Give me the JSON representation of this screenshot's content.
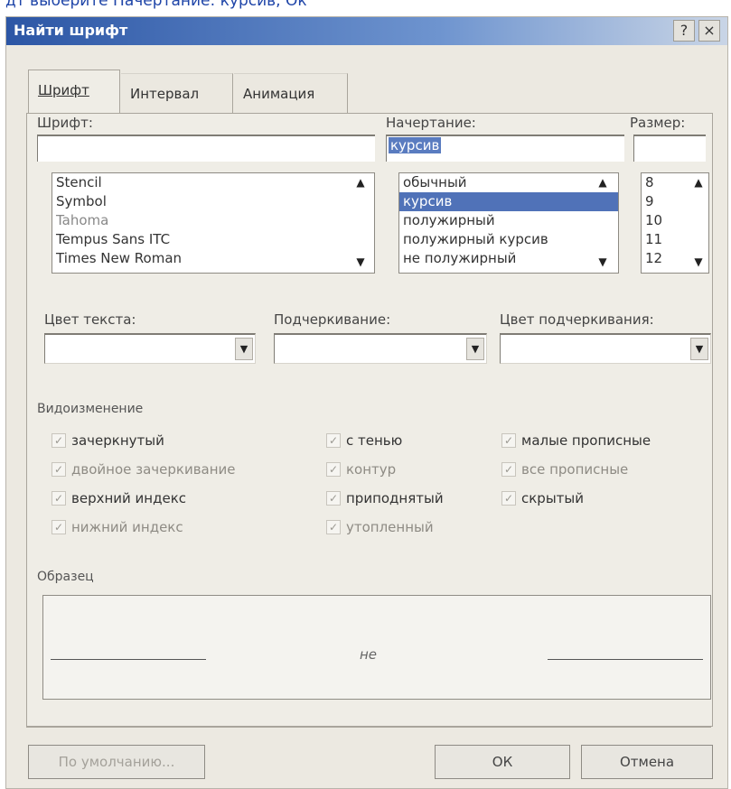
{
  "caption": "дт выберите Начертание: курсив, Ок",
  "window": {
    "title": "Найти шрифт",
    "help": "?",
    "close": "×"
  },
  "tabs": [
    "Шрифт",
    "Интервал",
    "Анимация"
  ],
  "font": {
    "label": "Шрифт:",
    "value": "",
    "items": [
      "Stencil",
      "Symbol",
      "Tahoma",
      "Tempus Sans ITC",
      "Times New Roman"
    ]
  },
  "style": {
    "label": "Начертание:",
    "value": "курсив",
    "items": [
      "обычный",
      "курсив",
      "полужирный",
      "полужирный курсив",
      "не полужирный"
    ],
    "selected": "курсив"
  },
  "size": {
    "label": "Размер:",
    "value": "",
    "items": [
      "8",
      "9",
      "10",
      "11",
      "12"
    ]
  },
  "text_color": {
    "label": "Цвет текста:",
    "value": ""
  },
  "underline": {
    "label": "Подчеркивание:",
    "value": ""
  },
  "underline_color": {
    "label": "Цвет подчеркивания:",
    "value": ""
  },
  "effects": {
    "title": "Видоизменение",
    "col1": [
      "зачеркнутый",
      "двойное зачеркивание",
      "верхний индекс",
      "нижний индекс"
    ],
    "col2": [
      "с тенью",
      "контур",
      "приподнятый",
      "утопленный"
    ],
    "col3": [
      "малые прописные",
      "все прописные",
      "скрытый"
    ]
  },
  "sample": {
    "title": "Образец",
    "text": "не"
  },
  "buttons": {
    "default": "По умолчанию...",
    "ok": "ОК",
    "cancel": "Отмена"
  },
  "colors": {
    "title_bar_start": "#2c56a5",
    "selection": "#5072b8",
    "dialog_bg": "#ece9e1"
  }
}
